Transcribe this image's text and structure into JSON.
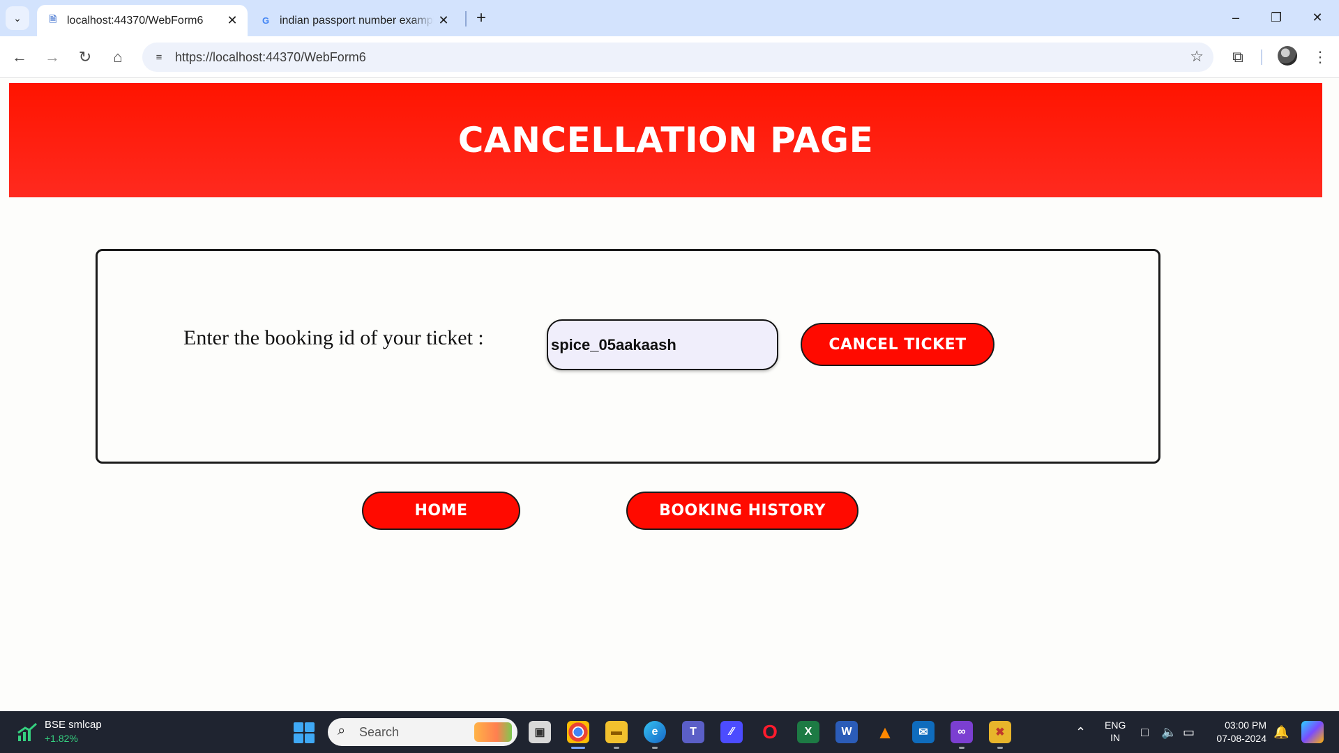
{
  "browser": {
    "tabs": [
      {
        "title": "localhost:44370/WebForm6",
        "favicon": "page-icon",
        "active": true
      },
      {
        "title": "indian passport number example",
        "favicon": "google-icon",
        "active": false
      }
    ],
    "url": "https://localhost:44370/WebForm6"
  },
  "page": {
    "header_title": "CANCELLATION PAGE",
    "prompt_label": "Enter the booking id of your ticket :",
    "booking_id_value": "spice_05aakaash",
    "cancel_button": "CANCEL TICKET",
    "home_button": "HOME",
    "history_button": "BOOKING HISTORY"
  },
  "taskbar": {
    "widget_title": "BSE smlcap",
    "widget_value": "+1.82%",
    "search_placeholder": "Search",
    "lang_line1": "ENG",
    "lang_line2": "IN",
    "time": "03:00 PM",
    "date": "07-08-2024"
  },
  "colors": {
    "accent_red": "#ff0a00",
    "header_red": "#ff1400",
    "tabbar": "#d3e3fd",
    "taskbar": "#1f2430"
  }
}
